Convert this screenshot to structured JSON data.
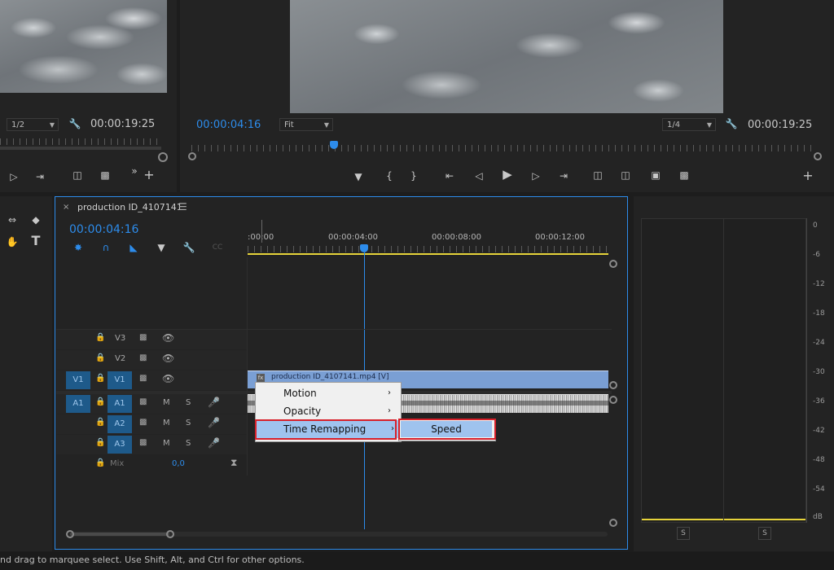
{
  "source_monitor": {
    "zoom_select": "1/2",
    "duration": "00:00:19:25"
  },
  "program_monitor": {
    "current_time": "00:00:04:16",
    "fit_select": "Fit",
    "resolution_select": "1/4",
    "duration": "00:00:19:25"
  },
  "timeline": {
    "tab_title": "production ID_4107141",
    "current_time": "00:00:04:16",
    "ruler_labels": [
      ":00:00",
      "00:00:04:00",
      "00:00:08:00",
      "00:00:12:00"
    ],
    "tracks": {
      "v3": "V3",
      "v2": "V2",
      "v1": "V1",
      "v1_source": "V1",
      "a1": "A1",
      "a1_source": "A1",
      "a2": "A2",
      "a3": "A3",
      "mute": "M",
      "solo": "S",
      "mix_label": "Mix",
      "mix_value": "0,0"
    },
    "clip_label": "production ID_4107141.mp4 [V]"
  },
  "context_menu": {
    "items": [
      "Motion",
      "Opacity",
      "Time Remapping"
    ],
    "submenu_item": "Speed"
  },
  "audio_meter": {
    "scale": [
      "0",
      "-6",
      "-12",
      "-18",
      "-24",
      "-30",
      "-36",
      "-42",
      "-48",
      "-54",
      "dB"
    ],
    "solo_left": "S",
    "solo_right": "S"
  },
  "status_bar": {
    "text": "nd drag to marquee select. Use Shift, Alt, and Ctrl for other options."
  },
  "colors": {
    "accent": "#2d8ceb",
    "highlight": "#d8202a",
    "clip_video": "#7a9fd4",
    "work_area": "#e6d33a"
  }
}
